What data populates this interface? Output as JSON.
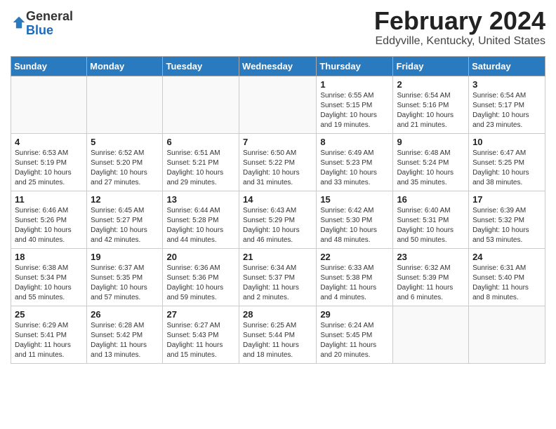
{
  "header": {
    "logo_general": "General",
    "logo_blue": "Blue",
    "month_year": "February 2024",
    "location": "Eddyville, Kentucky, United States"
  },
  "days_of_week": [
    "Sunday",
    "Monday",
    "Tuesday",
    "Wednesday",
    "Thursday",
    "Friday",
    "Saturday"
  ],
  "weeks": [
    [
      {
        "day": "",
        "info": ""
      },
      {
        "day": "",
        "info": ""
      },
      {
        "day": "",
        "info": ""
      },
      {
        "day": "",
        "info": ""
      },
      {
        "day": "1",
        "info": "Sunrise: 6:55 AM\nSunset: 5:15 PM\nDaylight: 10 hours\nand 19 minutes."
      },
      {
        "day": "2",
        "info": "Sunrise: 6:54 AM\nSunset: 5:16 PM\nDaylight: 10 hours\nand 21 minutes."
      },
      {
        "day": "3",
        "info": "Sunrise: 6:54 AM\nSunset: 5:17 PM\nDaylight: 10 hours\nand 23 minutes."
      }
    ],
    [
      {
        "day": "4",
        "info": "Sunrise: 6:53 AM\nSunset: 5:19 PM\nDaylight: 10 hours\nand 25 minutes."
      },
      {
        "day": "5",
        "info": "Sunrise: 6:52 AM\nSunset: 5:20 PM\nDaylight: 10 hours\nand 27 minutes."
      },
      {
        "day": "6",
        "info": "Sunrise: 6:51 AM\nSunset: 5:21 PM\nDaylight: 10 hours\nand 29 minutes."
      },
      {
        "day": "7",
        "info": "Sunrise: 6:50 AM\nSunset: 5:22 PM\nDaylight: 10 hours\nand 31 minutes."
      },
      {
        "day": "8",
        "info": "Sunrise: 6:49 AM\nSunset: 5:23 PM\nDaylight: 10 hours\nand 33 minutes."
      },
      {
        "day": "9",
        "info": "Sunrise: 6:48 AM\nSunset: 5:24 PM\nDaylight: 10 hours\nand 35 minutes."
      },
      {
        "day": "10",
        "info": "Sunrise: 6:47 AM\nSunset: 5:25 PM\nDaylight: 10 hours\nand 38 minutes."
      }
    ],
    [
      {
        "day": "11",
        "info": "Sunrise: 6:46 AM\nSunset: 5:26 PM\nDaylight: 10 hours\nand 40 minutes."
      },
      {
        "day": "12",
        "info": "Sunrise: 6:45 AM\nSunset: 5:27 PM\nDaylight: 10 hours\nand 42 minutes."
      },
      {
        "day": "13",
        "info": "Sunrise: 6:44 AM\nSunset: 5:28 PM\nDaylight: 10 hours\nand 44 minutes."
      },
      {
        "day": "14",
        "info": "Sunrise: 6:43 AM\nSunset: 5:29 PM\nDaylight: 10 hours\nand 46 minutes."
      },
      {
        "day": "15",
        "info": "Sunrise: 6:42 AM\nSunset: 5:30 PM\nDaylight: 10 hours\nand 48 minutes."
      },
      {
        "day": "16",
        "info": "Sunrise: 6:40 AM\nSunset: 5:31 PM\nDaylight: 10 hours\nand 50 minutes."
      },
      {
        "day": "17",
        "info": "Sunrise: 6:39 AM\nSunset: 5:32 PM\nDaylight: 10 hours\nand 53 minutes."
      }
    ],
    [
      {
        "day": "18",
        "info": "Sunrise: 6:38 AM\nSunset: 5:34 PM\nDaylight: 10 hours\nand 55 minutes."
      },
      {
        "day": "19",
        "info": "Sunrise: 6:37 AM\nSunset: 5:35 PM\nDaylight: 10 hours\nand 57 minutes."
      },
      {
        "day": "20",
        "info": "Sunrise: 6:36 AM\nSunset: 5:36 PM\nDaylight: 10 hours\nand 59 minutes."
      },
      {
        "day": "21",
        "info": "Sunrise: 6:34 AM\nSunset: 5:37 PM\nDaylight: 11 hours\nand 2 minutes."
      },
      {
        "day": "22",
        "info": "Sunrise: 6:33 AM\nSunset: 5:38 PM\nDaylight: 11 hours\nand 4 minutes."
      },
      {
        "day": "23",
        "info": "Sunrise: 6:32 AM\nSunset: 5:39 PM\nDaylight: 11 hours\nand 6 minutes."
      },
      {
        "day": "24",
        "info": "Sunrise: 6:31 AM\nSunset: 5:40 PM\nDaylight: 11 hours\nand 8 minutes."
      }
    ],
    [
      {
        "day": "25",
        "info": "Sunrise: 6:29 AM\nSunset: 5:41 PM\nDaylight: 11 hours\nand 11 minutes."
      },
      {
        "day": "26",
        "info": "Sunrise: 6:28 AM\nSunset: 5:42 PM\nDaylight: 11 hours\nand 13 minutes."
      },
      {
        "day": "27",
        "info": "Sunrise: 6:27 AM\nSunset: 5:43 PM\nDaylight: 11 hours\nand 15 minutes."
      },
      {
        "day": "28",
        "info": "Sunrise: 6:25 AM\nSunset: 5:44 PM\nDaylight: 11 hours\nand 18 minutes."
      },
      {
        "day": "29",
        "info": "Sunrise: 6:24 AM\nSunset: 5:45 PM\nDaylight: 11 hours\nand 20 minutes."
      },
      {
        "day": "",
        "info": ""
      },
      {
        "day": "",
        "info": ""
      }
    ]
  ]
}
